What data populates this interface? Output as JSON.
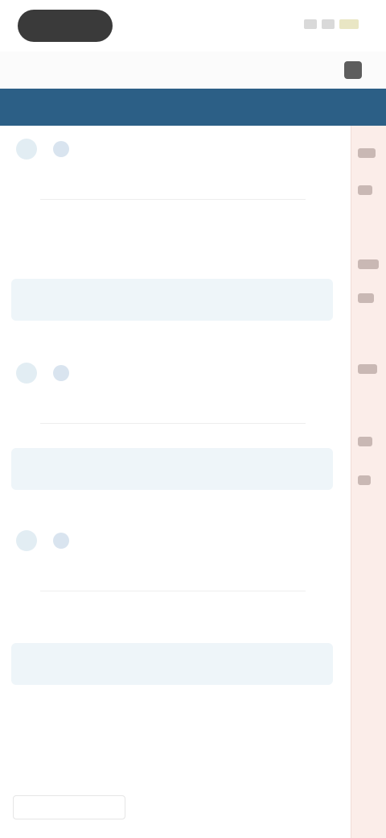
{
  "status_bar": {
    "time": "",
    "icons": [
      "signal-icon",
      "wifi-icon",
      "battery-icon"
    ]
  },
  "sub_header": {
    "left_text": "",
    "right_icon": "menu-icon",
    "right_text": ""
  },
  "title_bar": {
    "title": ""
  },
  "sections": [
    {
      "title": "",
      "subheading": "",
      "row_label": "",
      "row_value": "",
      "subrow_label": "",
      "tabs": [
        "",
        "",
        "",
        ""
      ]
    },
    {
      "title": "",
      "subheading": "",
      "tabs": [
        "",
        "",
        "",
        ""
      ]
    },
    {
      "title": "",
      "subheading": "",
      "row_label": "",
      "row_value": "",
      "tabs": [
        "",
        "",
        "",
        ""
      ]
    }
  ],
  "footer": {
    "title": "",
    "summary": "",
    "input_placeholder": "",
    "columns": [
      "",
      "",
      ""
    ]
  },
  "colors": {
    "header_bar": "#2c5f86",
    "right_panel": "#fbede9",
    "tab_bar": "#eef5f9"
  }
}
